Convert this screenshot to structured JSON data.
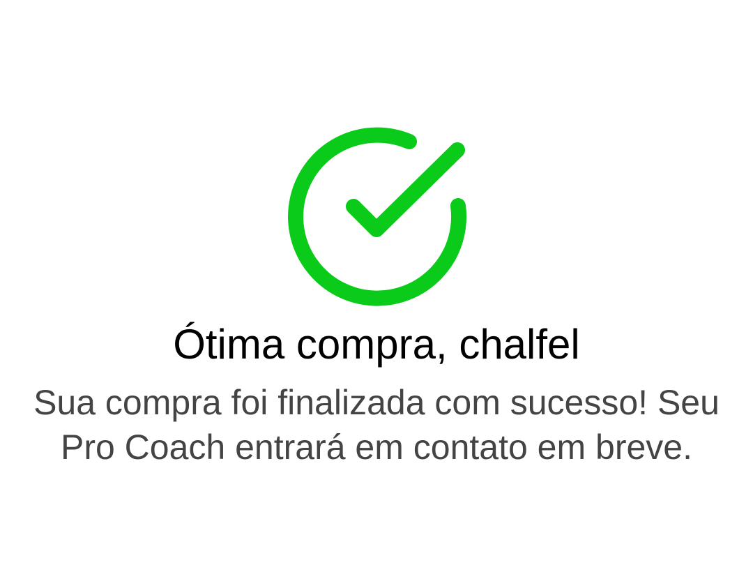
{
  "colors": {
    "success_green": "#0ACA1A",
    "title_text": "#000000",
    "message_text": "#444444",
    "background": "#FFFFFF"
  },
  "icon": {
    "name": "check-circle-icon"
  },
  "confirmation": {
    "title": "Ótima compra, chalfel",
    "message": "Sua compra foi finalizada com sucesso! Seu Pro Coach entrará em contato em breve."
  }
}
